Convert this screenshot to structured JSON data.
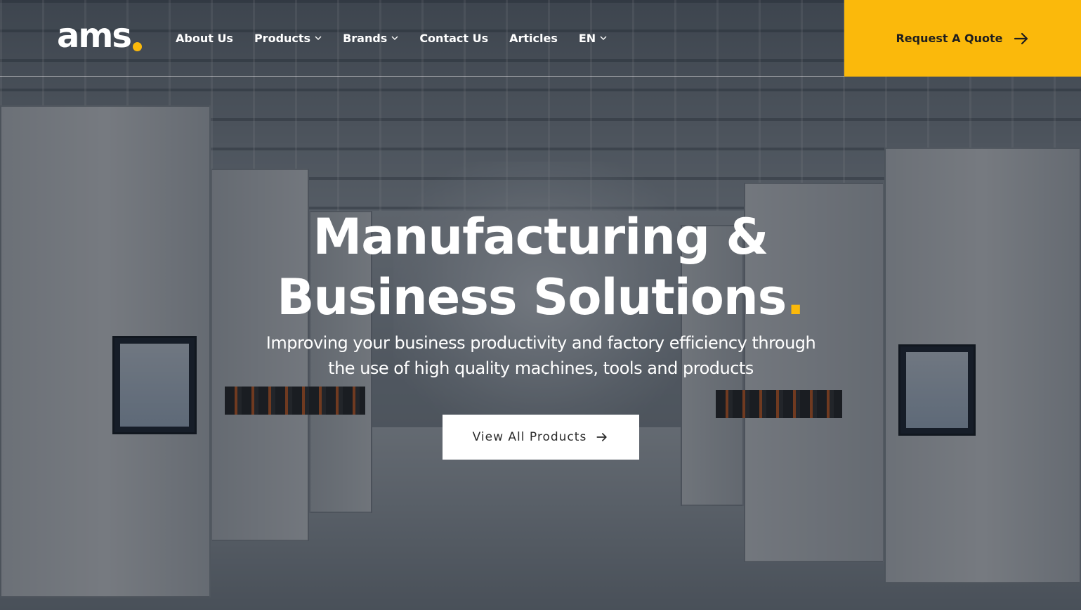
{
  "brand": {
    "logo_text": "ams",
    "accent_color": "#fbb90b"
  },
  "nav": {
    "items": [
      {
        "label": "About Us",
        "has_dropdown": false
      },
      {
        "label": "Products",
        "has_dropdown": true
      },
      {
        "label": "Brands",
        "has_dropdown": true
      },
      {
        "label": "Contact Us",
        "has_dropdown": false
      },
      {
        "label": "Articles",
        "has_dropdown": false
      },
      {
        "label": "EN",
        "has_dropdown": true
      }
    ],
    "quote_button": {
      "label": "Request A Quote",
      "icon": "arrow-right-icon"
    }
  },
  "hero": {
    "headline_line1": "Manufacturing &",
    "headline_line2": "Business Solutions",
    "headline_dot": ".",
    "subtitle_line1": "Improving your business productivity and factory efficiency through",
    "subtitle_line2": "the use of high quality machines, tools and products",
    "cta": {
      "label": "View All Products",
      "icon": "arrow-right-icon"
    },
    "background": "factory-cleanroom-photo"
  }
}
